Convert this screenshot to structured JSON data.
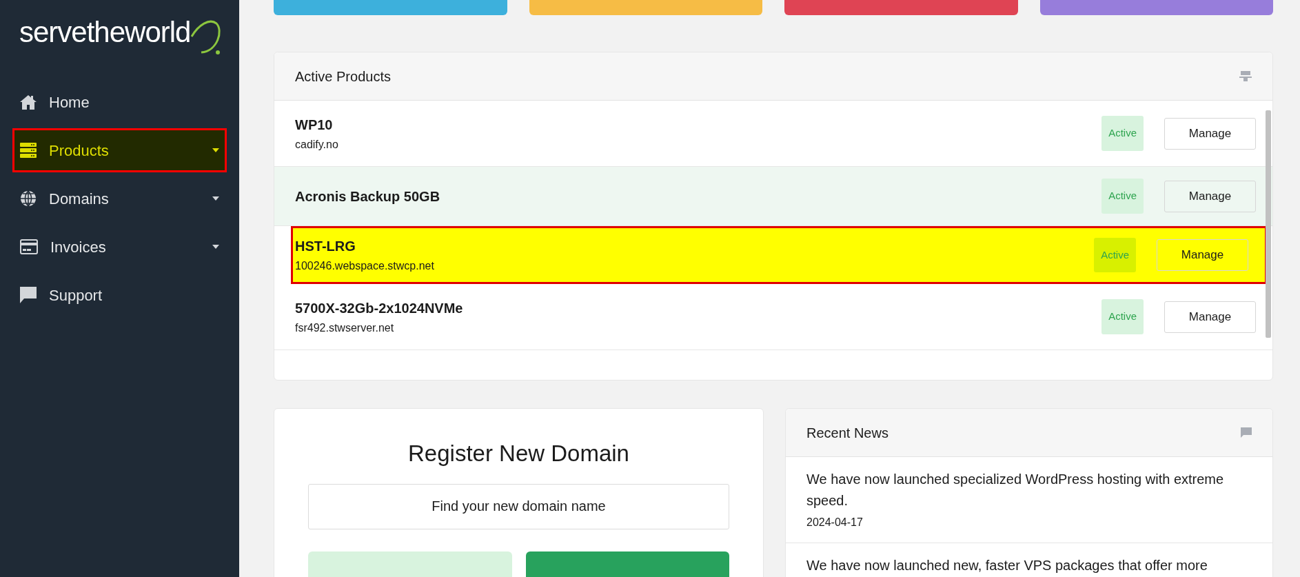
{
  "logo": {
    "text": "servetheworld"
  },
  "sidebar": {
    "items": [
      {
        "label": "Home",
        "kind": "home",
        "expandable": false,
        "selected": false
      },
      {
        "label": "Products",
        "kind": "server",
        "expandable": true,
        "selected": true
      },
      {
        "label": "Domains",
        "kind": "globe",
        "expandable": true,
        "selected": false
      },
      {
        "label": "Invoices",
        "kind": "card",
        "expandable": true,
        "selected": false
      },
      {
        "label": "Support",
        "kind": "comment",
        "expandable": false,
        "selected": false
      }
    ]
  },
  "stat_tiles": [
    {
      "color": "#3db0dc"
    },
    {
      "color": "#f6bc45"
    },
    {
      "color": "#df4454"
    },
    {
      "color": "#977ddb"
    }
  ],
  "active_products": {
    "title": "Active Products",
    "rows": [
      {
        "name": "WP10",
        "domain": "cadify.no",
        "status": "Active",
        "action": "Manage",
        "hovered": false,
        "selected": false
      },
      {
        "name": "Acronis Backup 50GB",
        "status": "Active",
        "action": "Manage",
        "hovered": true,
        "selected": false
      },
      {
        "name": "HST-LRG",
        "domain": "100246.webspace.stwcp.net",
        "status": "Active",
        "action": "Manage",
        "hovered": false,
        "selected": true
      },
      {
        "name": "5700X-32Gb-2x1024NVMe",
        "domain": "fsr492.stwserver.net",
        "status": "Active",
        "action": "Manage",
        "hovered": false,
        "selected": false
      }
    ]
  },
  "register_domain": {
    "title": "Register New Domain",
    "search": {
      "placeholder": "Find your new domain name"
    }
  },
  "recent_news": {
    "title": "Recent News",
    "items": [
      {
        "text": "We have now launched specialized WordPress hosting with extreme speed.",
        "date": "2024-04-17"
      },
      {
        "text": "We have now launched new, faster VPS packages that offer more"
      }
    ]
  }
}
